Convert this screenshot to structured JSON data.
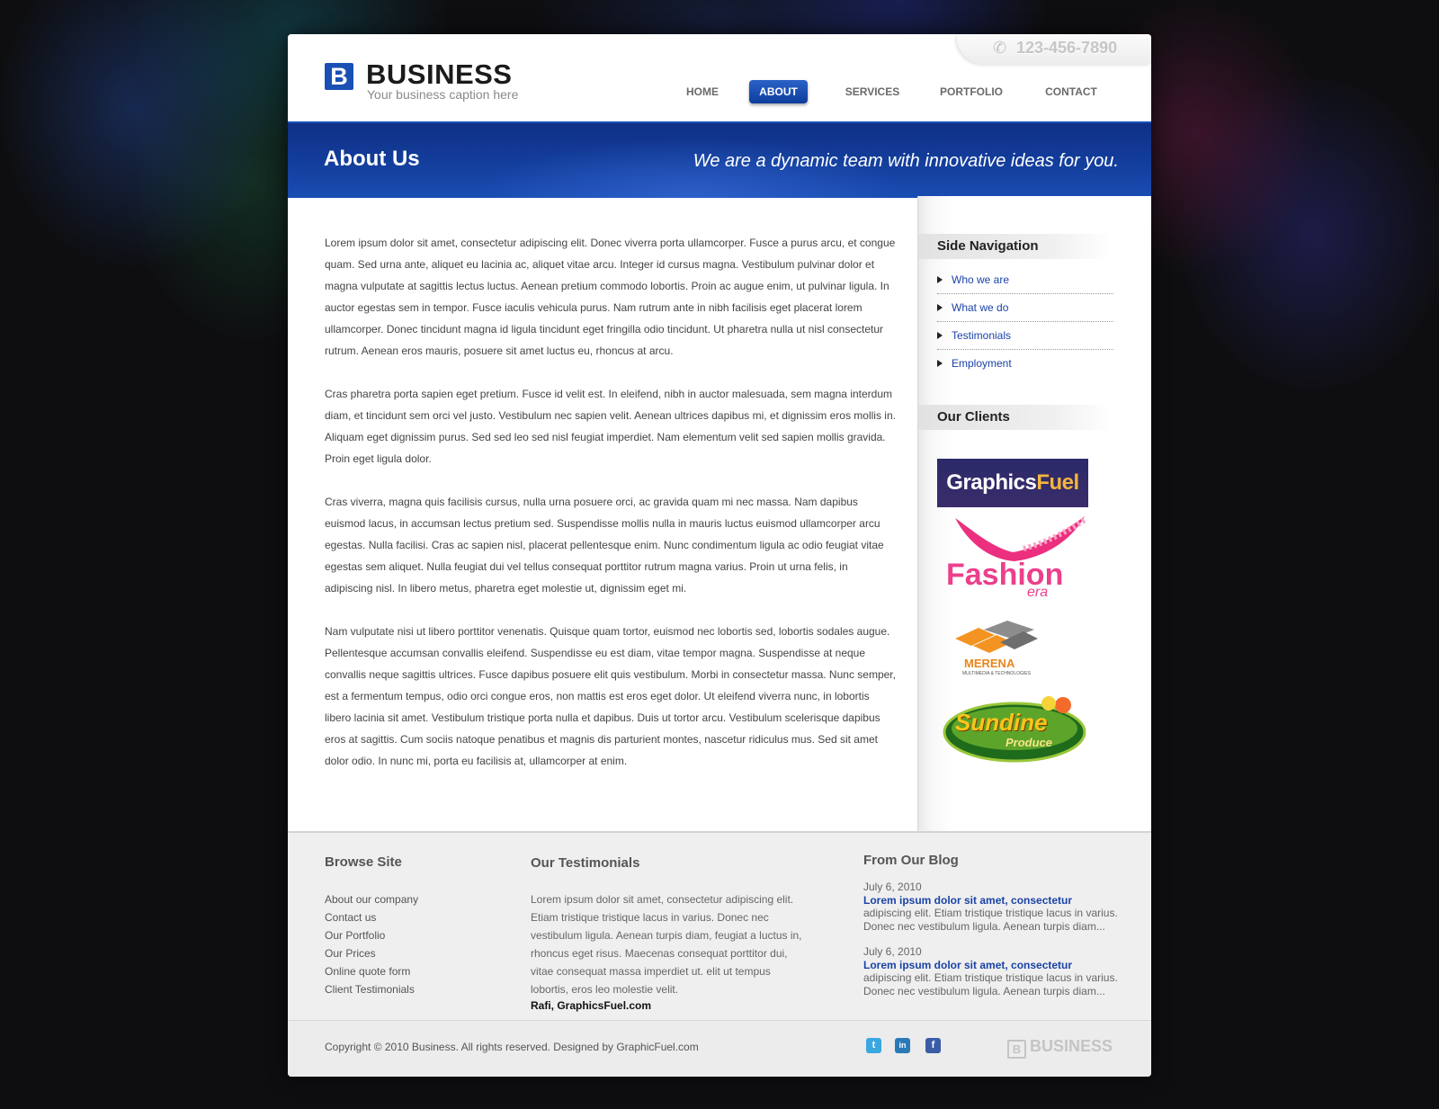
{
  "header": {
    "logo_mark": "B",
    "logo_name": "BUSINESS",
    "logo_caption": "Your business caption here",
    "phone": "123-456-7890"
  },
  "nav": {
    "items": [
      "HOME",
      "ABOUT",
      "SERVICES",
      "PORTFOLIO",
      "CONTACT"
    ],
    "active": "ABOUT"
  },
  "banner": {
    "title": "About Us",
    "tagline": "We are a dynamic team with innovative ideas for you."
  },
  "main": {
    "paragraphs": [
      "Lorem ipsum dolor sit amet, consectetur adipiscing elit. Donec viverra porta ullamcorper. Fusce a purus arcu, et congue quam. Sed urna ante, aliquet eu lacinia ac, aliquet vitae arcu. Integer id cursus magna. Vestibulum pulvinar dolor et magna vulputate at sagittis lectus luctus. Aenean pretium commodo lobortis. Proin ac augue enim, ut pulvinar ligula. In auctor egestas sem in tempor. Fusce iaculis vehicula purus. Nam rutrum ante in nibh facilisis eget placerat lorem ullamcorper. Donec tincidunt magna id ligula tincidunt eget fringilla odio tincidunt. Ut pharetra nulla ut nisl consectetur rutrum. Aenean eros mauris, posuere sit amet luctus eu, rhoncus at arcu.",
      "Cras pharetra porta sapien eget pretium. Fusce id velit est. In eleifend, nibh in auctor malesuada, sem magna interdum diam, et tincidunt sem orci vel justo. Vestibulum nec sapien velit. Aenean ultrices dapibus mi, et dignissim eros mollis in. Aliquam eget dignissim purus. Sed sed leo sed nisl feugiat imperdiet. Nam elementum velit sed sapien mollis gravida. Proin eget ligula dolor.",
      "Cras viverra, magna quis facilisis cursus, nulla urna posuere orci, ac gravida quam mi nec massa. Nam dapibus euismod lacus, in accumsan lectus pretium sed. Suspendisse mollis nulla in mauris luctus euismod ullamcorper arcu egestas. Nulla facilisi. Cras ac sapien nisl, placerat pellentesque enim. Nunc condimentum ligula ac odio feugiat vitae egestas sem aliquet. Nulla feugiat dui vel tellus consequat porttitor rutrum magna varius. Proin ut urna felis, in adipiscing nisl. In libero metus, pharetra eget molestie ut, dignissim eget mi.",
      "Nam vulputate nisi ut libero porttitor venenatis. Quisque quam tortor, euismod nec lobortis sed, lobortis sodales augue. Pellentesque accumsan convallis eleifend. Suspendisse eu est diam, vitae tempor magna. Suspendisse at neque convallis neque sagittis ultrices. Fusce dapibus posuere elit quis vestibulum. Morbi in consectetur massa. Nunc semper, est a fermentum tempus, odio orci congue eros, non mattis est eros eget dolor. Ut eleifend viverra nunc, in lobortis libero lacinia sit amet. Vestibulum tristique porta nulla et dapibus. Duis ut tortor arcu. Vestibulum scelerisque dapibus eros at sagittis. Cum sociis natoque penatibus et magnis dis parturient montes, nascetur ridiculus mus. Sed sit amet dolor odio. In nunc mi, porta eu facilisis at, ullamcorper at enim."
    ]
  },
  "sidebar": {
    "nav_heading": "Side Navigation",
    "nav_items": [
      "Who we are",
      "What we do",
      "Testimonials",
      "Employment"
    ],
    "clients_heading": "Our Clients",
    "clients": [
      {
        "name_a": "Graphics",
        "name_b": "Fuel"
      },
      {
        "name_a": "Fashion",
        "name_b": "era"
      },
      {
        "name_a": "MERENA",
        "name_b": "MULTIMEDIA & TECHNOLOGIES"
      },
      {
        "name_a": "Sundine",
        "name_b": "Produce"
      }
    ]
  },
  "footer": {
    "browse_heading": "Browse Site",
    "browse_links": [
      "About our company",
      "Contact us",
      "Our Portfolio",
      "Our Prices",
      "Online quote form",
      "Client Testimonials"
    ],
    "testimonials_heading": "Our Testimonials",
    "testimonial_text": "Lorem ipsum dolor sit amet, consectetur adipiscing elit. Etiam tristique tristique lacus in varius. Donec nec vestibulum ligula. Aenean turpis diam, feugiat a luctus in, rhoncus eget risus. Maecenas consequat porttitor dui, vitae consequat massa imperdiet ut. elit ut tempus lobortis, eros leo molestie velit.",
    "testimonial_author": "Rafi, GraphicsFuel.com",
    "blog_heading": "From Our Blog",
    "blog_posts": [
      {
        "date": "July 6, 2010",
        "title": "Lorem ipsum dolor sit amet, consectetur",
        "excerpt": "adipiscing elit. Etiam tristique tristique lacus in varius. Donec nec vestibulum ligula. Aenean turpis diam..."
      },
      {
        "date": "July 6, 2010",
        "title": "Lorem ipsum dolor sit amet, consectetur",
        "excerpt": "adipiscing elit. Etiam tristique tristique lacus in varius. Donec nec vestibulum ligula. Aenean turpis diam..."
      }
    ],
    "copyright": "Copyright © 2010 Business. All rights reserved. Designed by GraphicFuel.com",
    "social": [
      {
        "icon": "twitter-icon",
        "glyph": "t",
        "color": "#3aa7e0"
      },
      {
        "icon": "linkedin-icon",
        "glyph": "in",
        "color": "#2a7ab8"
      },
      {
        "icon": "facebook-icon",
        "glyph": "f",
        "color": "#3b5ca6"
      }
    ],
    "footer_logo_mark": "B",
    "footer_logo_name": "BUSINESS"
  },
  "colors": {
    "brand_blue": "#1a4fb5",
    "link_blue": "#1b43a6"
  }
}
